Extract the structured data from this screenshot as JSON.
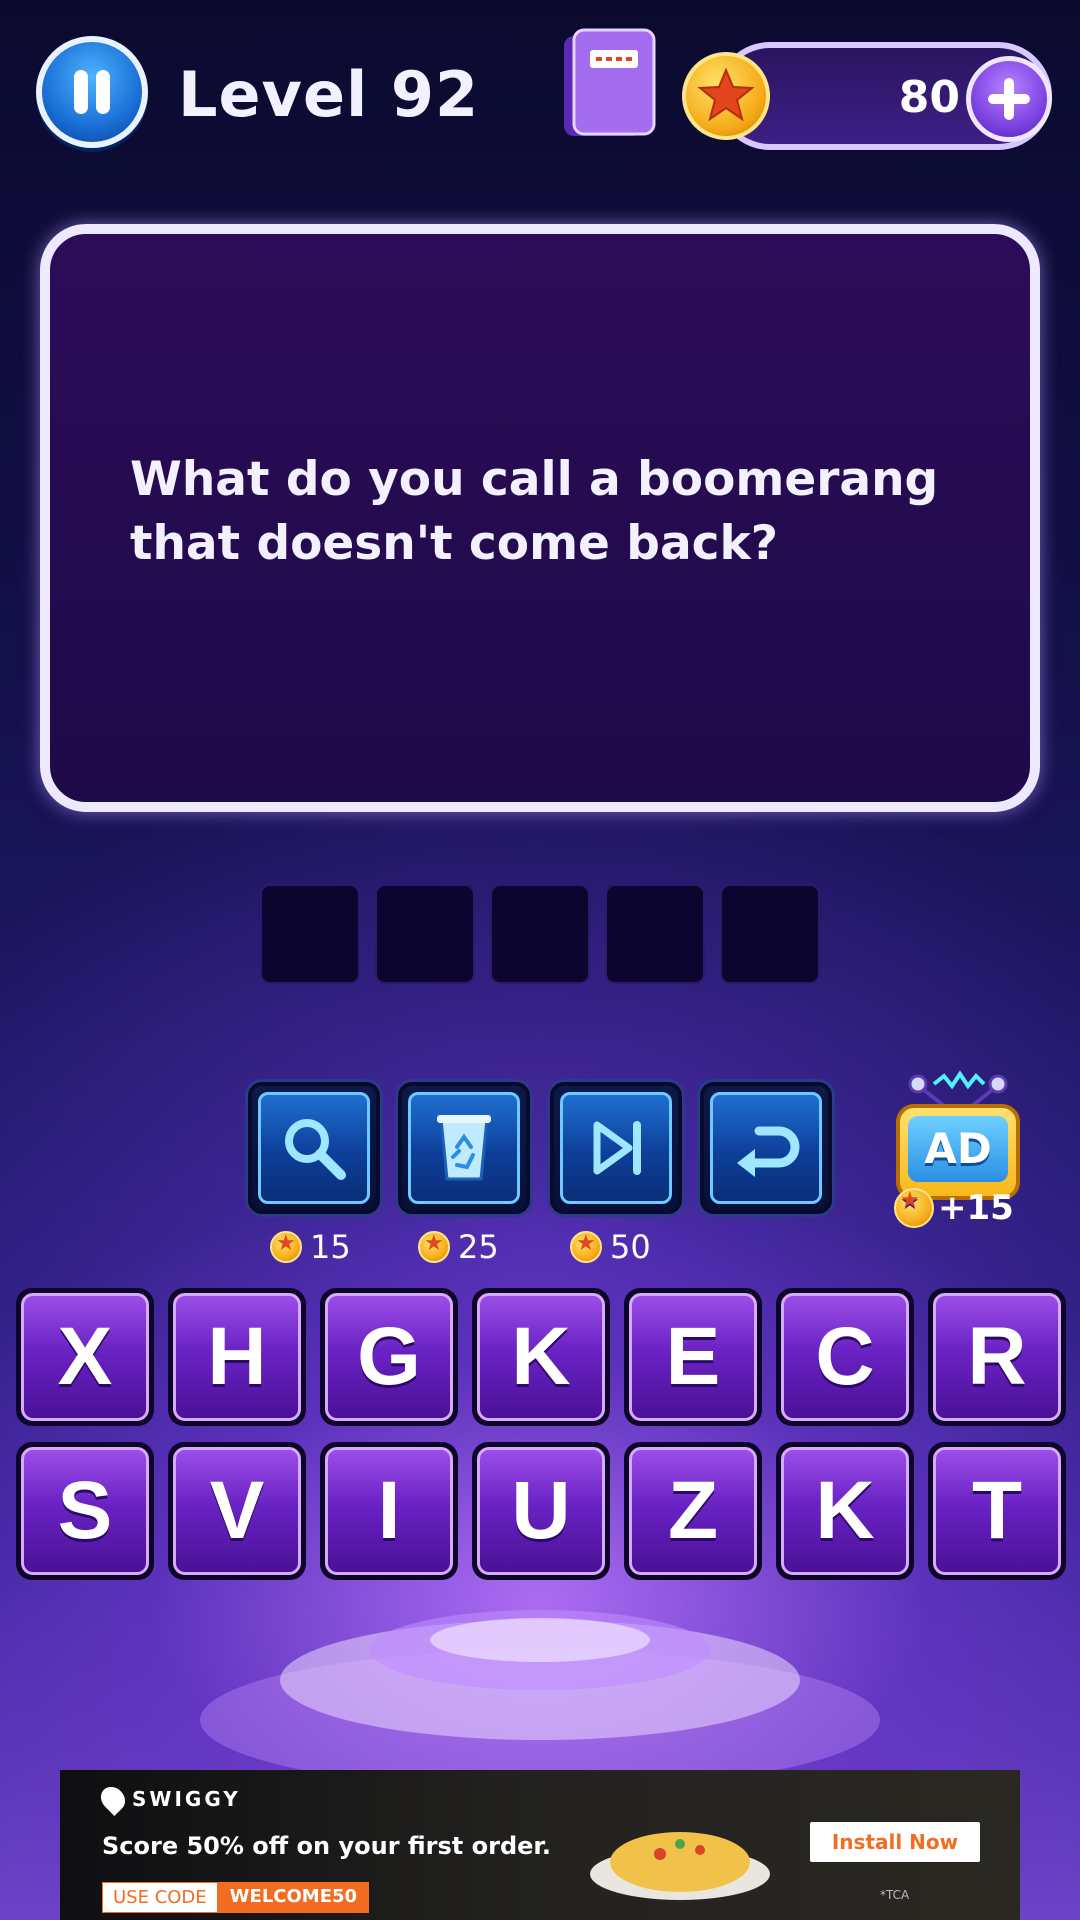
{
  "header": {
    "level_label": "Level 92",
    "coin_count": "80"
  },
  "question": {
    "text": "What do you call a boomerang that doesn't come back?"
  },
  "answer": {
    "slot_count": 5,
    "letters": [
      "",
      "",
      "",
      "",
      ""
    ]
  },
  "tools": [
    {
      "name": "search",
      "cost": "15"
    },
    {
      "name": "remove",
      "cost": "25"
    },
    {
      "name": "skip",
      "cost": "50"
    },
    {
      "name": "undo",
      "cost": ""
    }
  ],
  "ad_reward": {
    "label": "AD",
    "reward": "+15"
  },
  "keyboard": {
    "row1": [
      "X",
      "H",
      "G",
      "K",
      "E",
      "C",
      "R"
    ],
    "row2": [
      "S",
      "V",
      "I",
      "U",
      "Z",
      "K",
      "T"
    ]
  },
  "banner": {
    "brand": "SWIGGY",
    "headline": "Score 50% off on your first order.",
    "code_label": "USE CODE",
    "code_value": "WELCOME50",
    "install_label": "Install Now",
    "tc": "*TCA"
  },
  "colors": {
    "accent_purple": "#7a3fe0",
    "coin_gold": "#f5a916",
    "tool_blue": "#1f6fd0",
    "banner_orange": "#f26c22"
  }
}
